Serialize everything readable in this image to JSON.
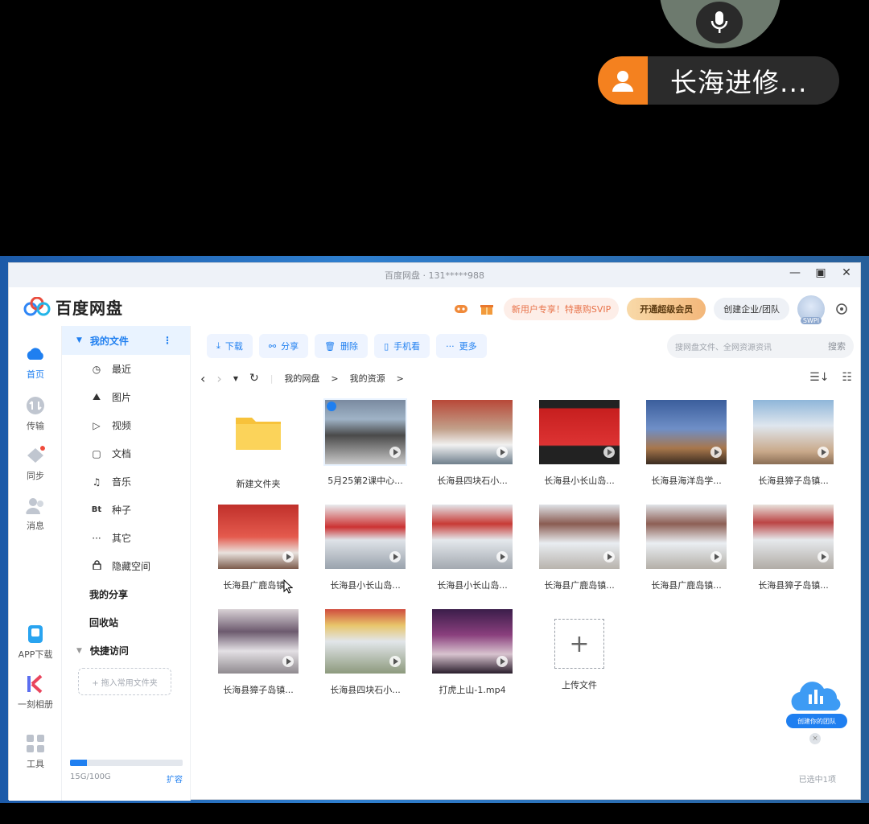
{
  "call": {
    "caller_name": "长海进修..."
  },
  "window": {
    "title": "百度网盘  ·  131*****988"
  },
  "header": {
    "logo_text": "百度网盘",
    "promo": "新用户专享！特惠购SVIP",
    "svip_button": "开通超级会员",
    "team_button": "创建企业/团队",
    "avatar_badge": "SWPI"
  },
  "rail": {
    "items": [
      {
        "label": "首页",
        "icon": "cloud-home-icon"
      },
      {
        "label": "传输",
        "icon": "transfer-icon"
      },
      {
        "label": "同步",
        "icon": "sync-icon"
      },
      {
        "label": "消息",
        "icon": "message-icon"
      },
      {
        "label": "APP下载",
        "icon": "phone-download-icon"
      },
      {
        "label": "一刻相册",
        "icon": "album-icon"
      },
      {
        "label": "工具",
        "icon": "tools-icon"
      }
    ]
  },
  "sidebar": {
    "my_files": "我的文件",
    "more": "⋮",
    "items": [
      {
        "label": "最近",
        "glyph": "◷"
      },
      {
        "label": "图片",
        "glyph": "⛰"
      },
      {
        "label": "视频",
        "glyph": "▷"
      },
      {
        "label": "文档",
        "glyph": "▢"
      },
      {
        "label": "音乐",
        "glyph": "♫"
      },
      {
        "label": "种子",
        "glyph": "Bt"
      },
      {
        "label": "其它",
        "glyph": "···"
      },
      {
        "label": "隐藏空间",
        "glyph": "🔒"
      }
    ],
    "my_share": "我的分享",
    "recycle": "回收站",
    "quick_access": "快捷访问",
    "drop_hint": "+ 拖入常用文件夹",
    "quota_text": "15G/100G",
    "quota_fraction": 0.15,
    "expand": "扩容"
  },
  "toolbar": {
    "download": "下载",
    "share": "分享",
    "delete": "删除",
    "phone_view": "手机看",
    "more": "更多"
  },
  "search": {
    "placeholder": "搜网盘文件、全网资源资讯",
    "button": "搜索"
  },
  "breadcrumb": {
    "root": "我的网盘",
    "sep1": ">",
    "current": "我的资源",
    "sep2": ">"
  },
  "files": [
    {
      "name": "新建文件夹",
      "kind": "folder"
    },
    {
      "name": "5月25第2课中心...",
      "kind": "video",
      "selected": true
    },
    {
      "name": "长海县四块石小...",
      "kind": "video"
    },
    {
      "name": "长海县小长山岛...",
      "kind": "video"
    },
    {
      "name": "长海县海洋岛学...",
      "kind": "video"
    },
    {
      "name": "长海县獐子岛镇...",
      "kind": "video"
    },
    {
      "name": "长海县广鹿岛镇...",
      "kind": "video"
    },
    {
      "name": "长海县小长山岛...",
      "kind": "video"
    },
    {
      "name": "长海县小长山岛...",
      "kind": "video"
    },
    {
      "name": "长海县广鹿岛镇...",
      "kind": "video"
    },
    {
      "name": "长海县广鹿岛镇...",
      "kind": "video"
    },
    {
      "name": "长海县獐子岛镇...",
      "kind": "video"
    },
    {
      "name": "长海县獐子岛镇...",
      "kind": "video"
    },
    {
      "name": "长海县四块石小...",
      "kind": "video"
    },
    {
      "name": "打虎上山-1.mp4",
      "kind": "video"
    },
    {
      "name": "上传文件",
      "kind": "upload"
    }
  ],
  "status": {
    "selected": "已选中1项"
  },
  "team_float": {
    "label": "创建你的团队",
    "close": "×"
  },
  "colors": {
    "accent": "#1f7ff0",
    "caller_orange": "#f4811f",
    "svip_gold": "#f3b77a"
  }
}
